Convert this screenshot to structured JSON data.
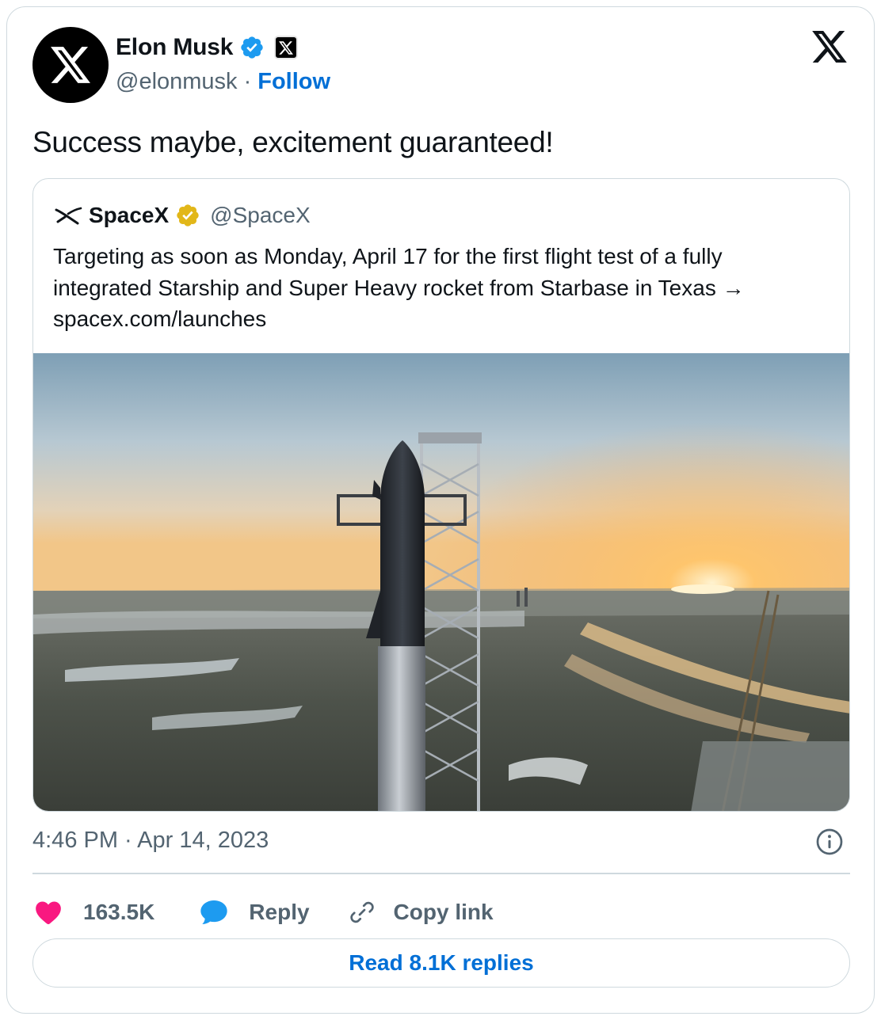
{
  "author": {
    "name": "Elon Musk",
    "handle": "@elonmusk",
    "separator": "·",
    "follow_label": "Follow",
    "avatar_icon": "x-logo-icon",
    "verified_color": "#1d9bf0"
  },
  "tweet": {
    "text": "Success maybe, excitement guaranteed!",
    "timestamp": "4:46 PM · Apr 14, 2023"
  },
  "quoted_tweet": {
    "name": "SpaceX",
    "handle": "@SpaceX",
    "verified_color": "#e2b719",
    "text_line1": "Targeting as soon as Monday, April 17 for the first flight test of a fully",
    "text_line2": "integrated Starship and Super Heavy rocket from Starbase in Texas →",
    "text_line3": "spacex.com/launches",
    "image_icon": "starship-launch-photo"
  },
  "actions": {
    "likes": "163.5K",
    "reply_label": "Reply",
    "copy_label": "Copy link",
    "like_color": "#f91880",
    "reply_color": "#1d9bf0"
  },
  "read_replies_label": "Read 8.1K replies",
  "accent_color": "#006fd6"
}
